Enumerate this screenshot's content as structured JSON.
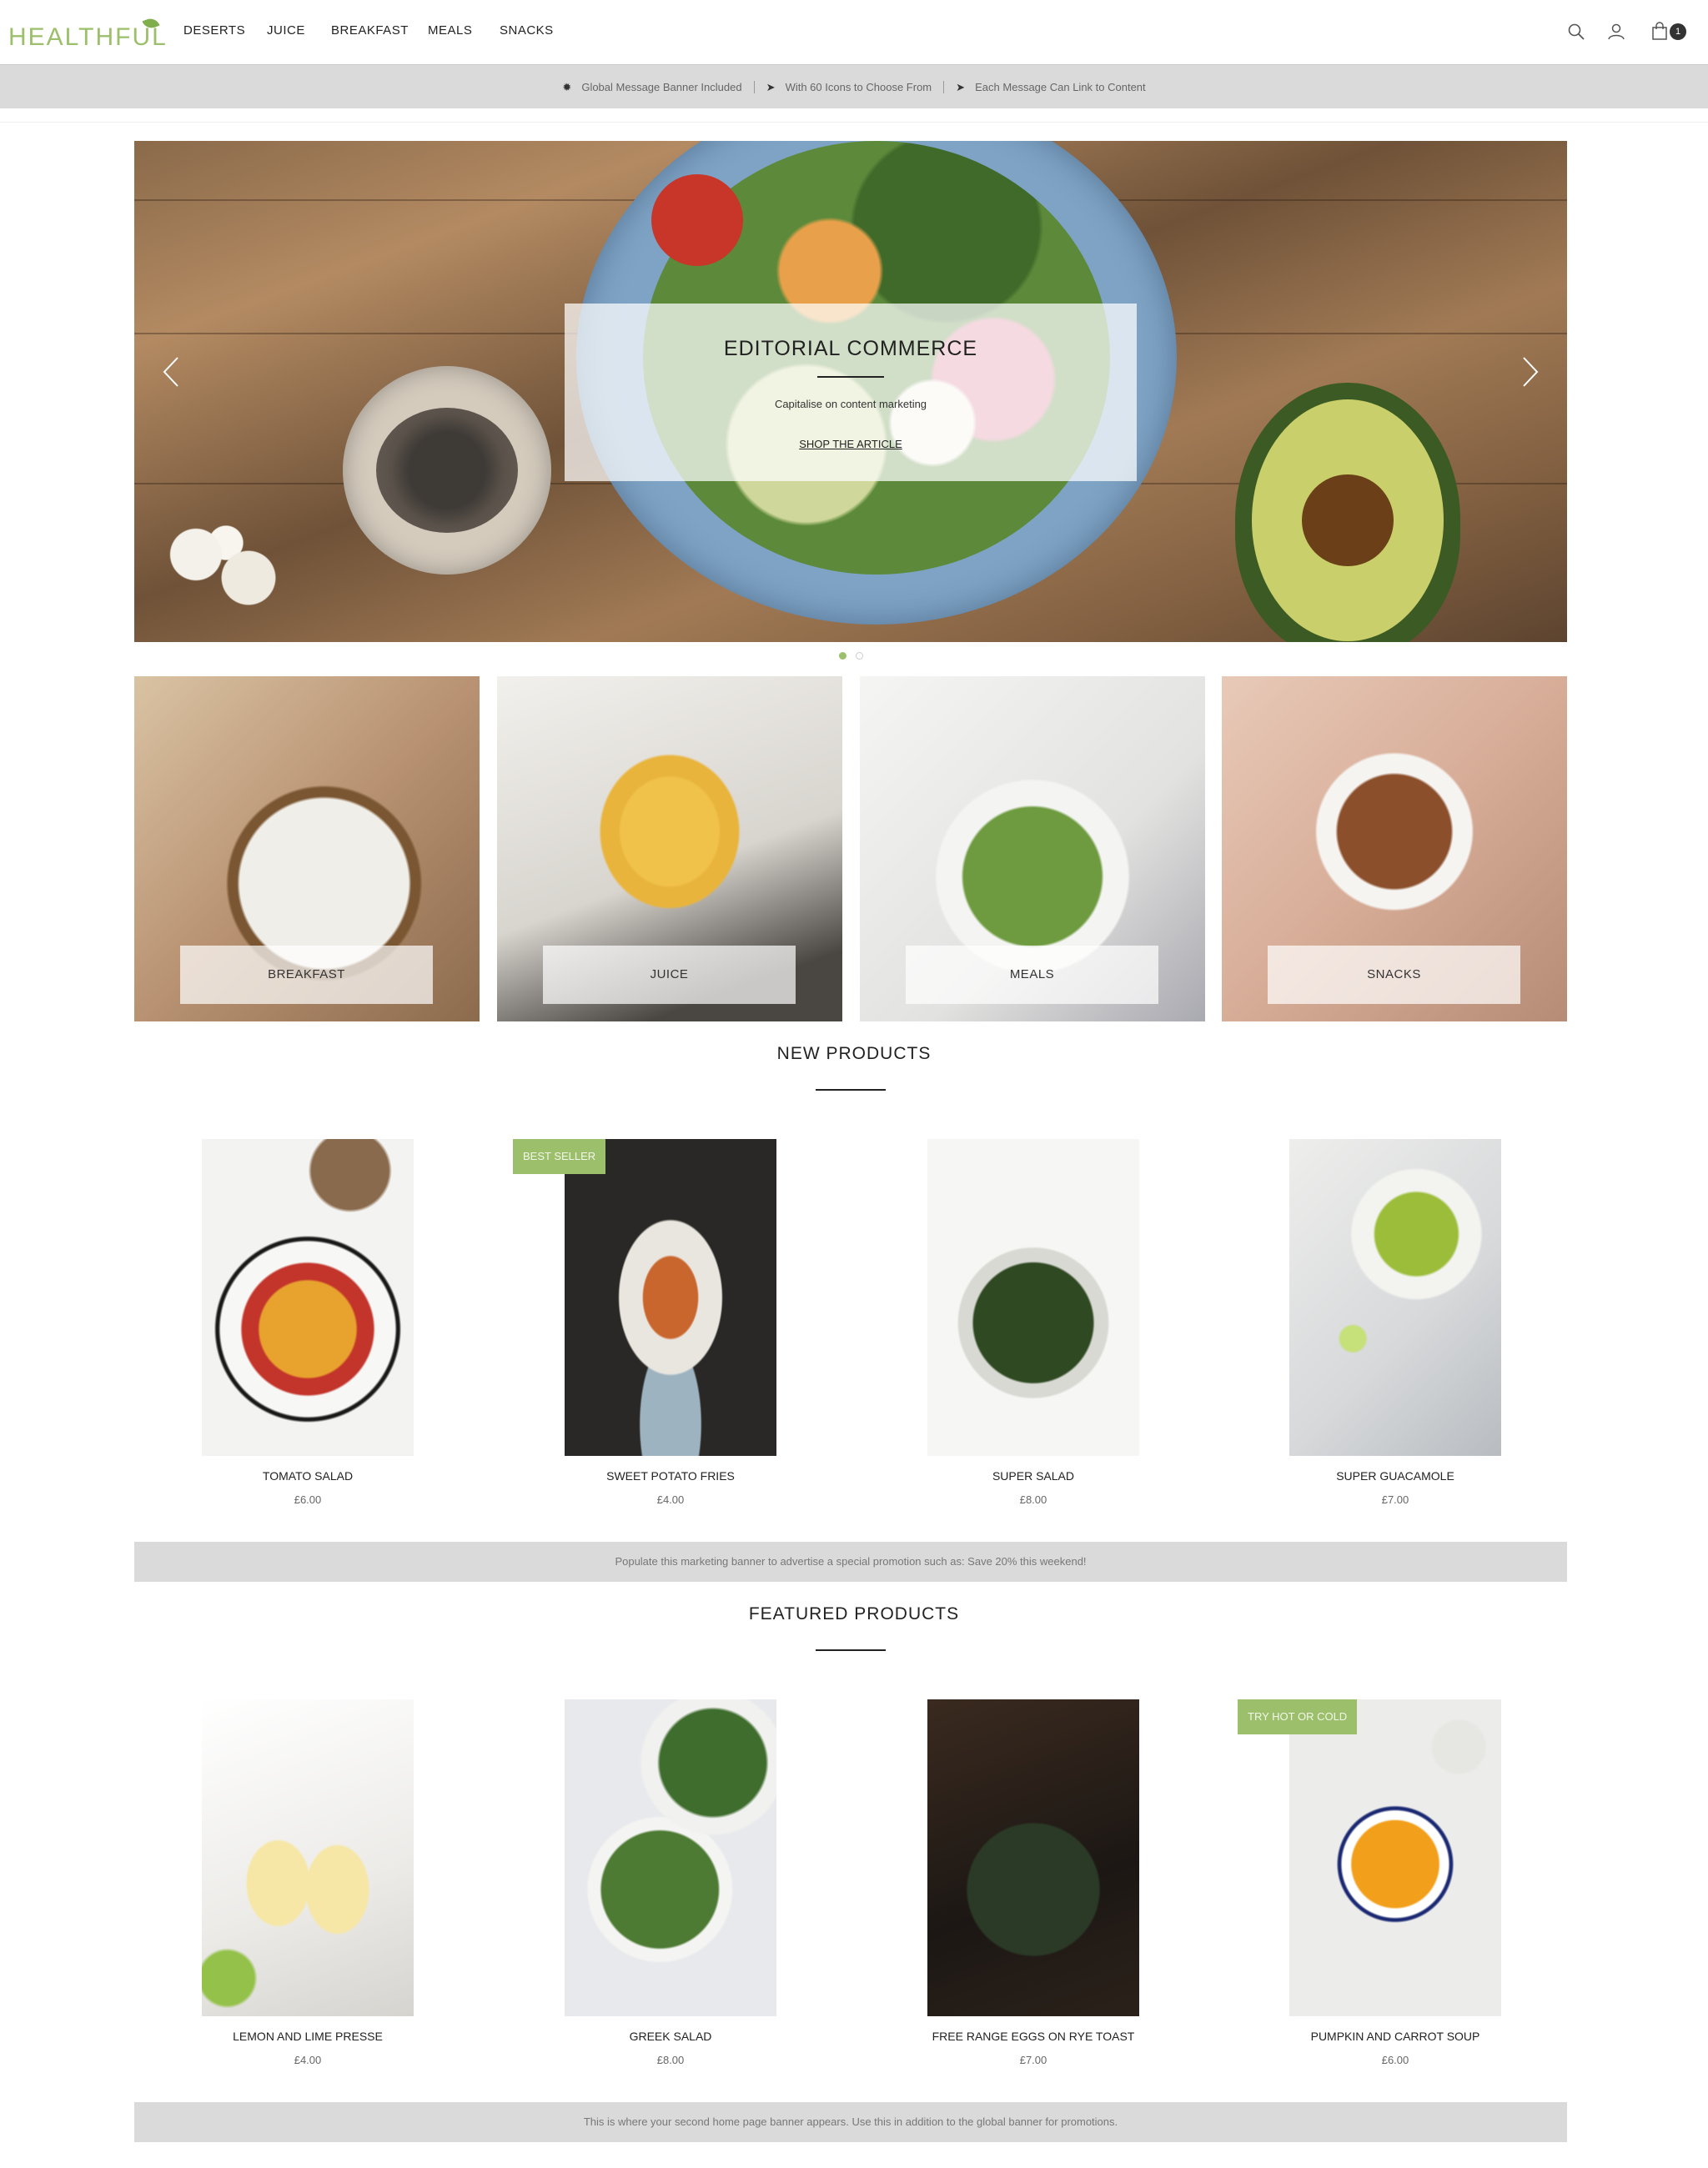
{
  "header": {
    "logo": "HEALTHFUL",
    "nav": [
      "DESERTS",
      "JUICE",
      "BREAKFAST",
      "MEALS",
      "SNACKS"
    ],
    "icons": {
      "search": "search-icon",
      "account": "user-icon",
      "cart": "bag-icon"
    },
    "cart_count": "1"
  },
  "global_banner": {
    "messages": [
      {
        "icon": "badge-icon",
        "text": "Global Message Banner Included"
      },
      {
        "icon": "paper-plane-icon",
        "text": "With 60 Icons to Choose From"
      },
      {
        "icon": "paper-plane-icon",
        "text": "Each Message Can Link to Content"
      }
    ]
  },
  "hero": {
    "title": "EDITORIAL COMMERCE",
    "subtitle": "Capitalise on content marketing",
    "cta": "SHOP THE ARTICLE",
    "slides": 2,
    "active_slide": 1
  },
  "categories": [
    "BREAKFAST",
    "JUICE",
    "MEALS",
    "SNACKS"
  ],
  "new_products": {
    "title": "NEW PRODUCTS",
    "items": [
      {
        "name": "TOMATO SALAD",
        "price": "£6.00",
        "badge": ""
      },
      {
        "name": "SWEET POTATO FRIES",
        "price": "£4.00",
        "badge": "BEST SELLER"
      },
      {
        "name": "SUPER SALAD",
        "price": "£8.00",
        "badge": ""
      },
      {
        "name": "SUPER GUACAMOLE",
        "price": "£7.00",
        "badge": ""
      }
    ]
  },
  "marketing_banner_1": "Populate this marketing banner to advertise a special promotion such as: Save 20% this weekend!",
  "featured_products": {
    "title": "FEATURED PRODUCTS",
    "items": [
      {
        "name": "LEMON AND LIME PRESSE",
        "price": "£4.00",
        "badge": ""
      },
      {
        "name": "GREEK SALAD",
        "price": "£8.00",
        "badge": ""
      },
      {
        "name": "FREE RANGE EGGS ON RYE TOAST",
        "price": "£7.00",
        "badge": ""
      },
      {
        "name": "PUMPKIN AND CARROT SOUP",
        "price": "£6.00",
        "badge": "TRY HOT OR COLD"
      }
    ]
  },
  "marketing_banner_2": "This is where your second home page banner appears. Use this in addition to the global banner for promotions.",
  "colors": {
    "accent": "#9bbf6a",
    "banner_bg": "#dadada",
    "text": "#222222"
  }
}
